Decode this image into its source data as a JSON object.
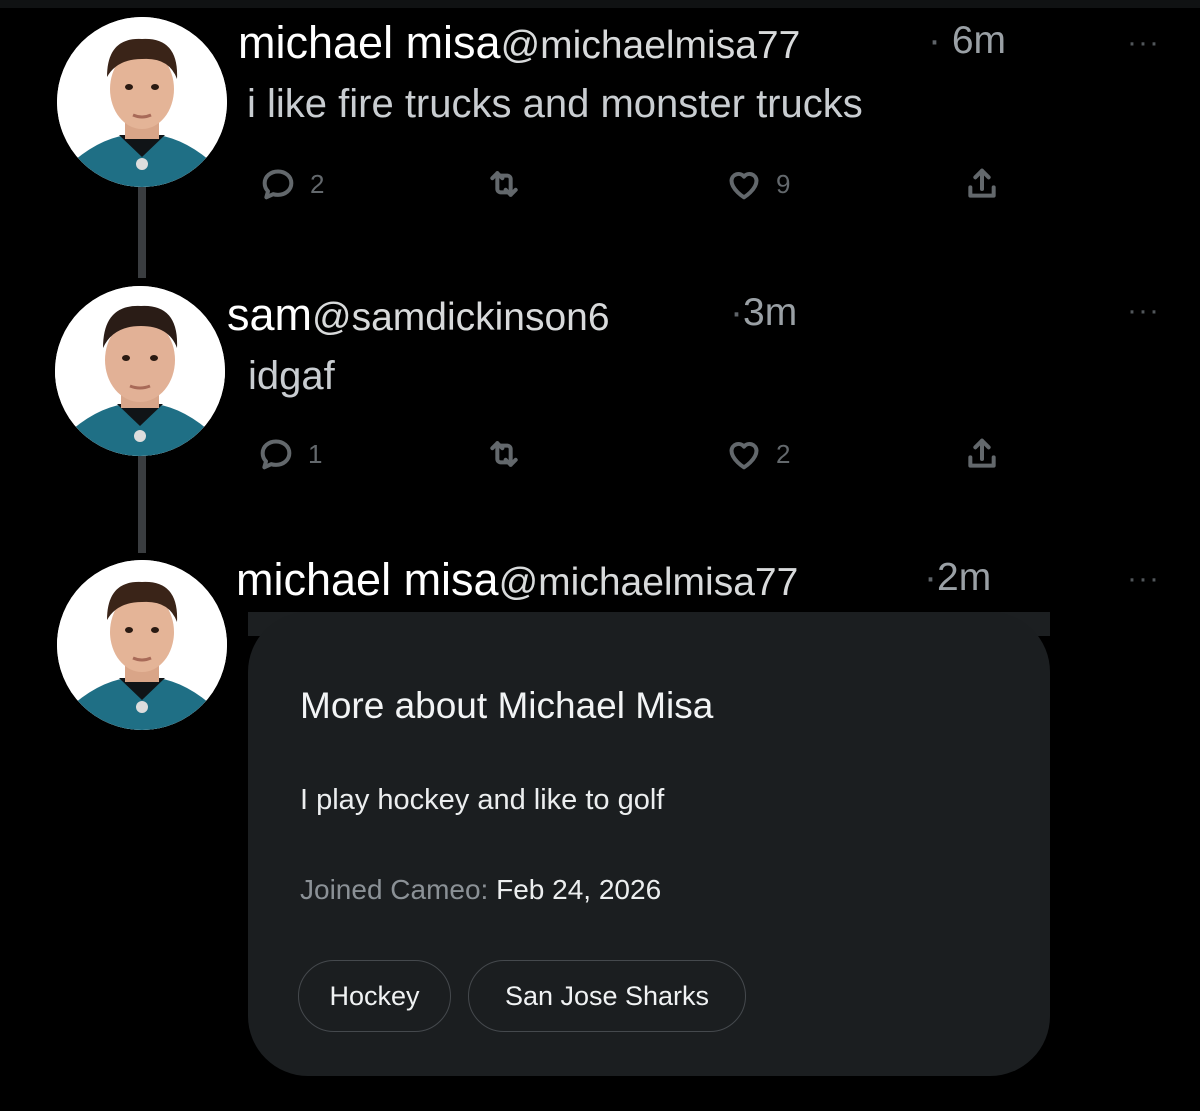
{
  "tweets": [
    {
      "name": "michael misa",
      "handle": "@michaelmisa77",
      "sep": "·",
      "time": "6m",
      "more": "···",
      "text": "i like fire trucks and monster trucks",
      "replies": "2",
      "retweets": "",
      "likes": "9"
    },
    {
      "name": "sam",
      "handle": "@samdickinson6",
      "sep": "·",
      "time": "3m",
      "more": "···",
      "text": "idgaf",
      "replies": "1",
      "retweets": "",
      "likes": "2"
    },
    {
      "name": "michael misa",
      "handle": "@michaelmisa77",
      "sep": "·",
      "time": "2m",
      "more": "···"
    }
  ],
  "card": {
    "title": "More about Michael Misa",
    "description": "I play hockey and like to golf",
    "joined_label": "Joined Cameo:",
    "joined_date": "Feb 24, 2026",
    "tags": [
      "Hockey",
      "San Jose Sharks"
    ]
  },
  "colors": {
    "background": "#000000",
    "card": "#1b1e20",
    "jersey_teal": "#1f6f85",
    "muted": "#63686c"
  },
  "icons": [
    "reply-icon",
    "retweet-icon",
    "like-icon",
    "share-icon",
    "more-icon"
  ]
}
